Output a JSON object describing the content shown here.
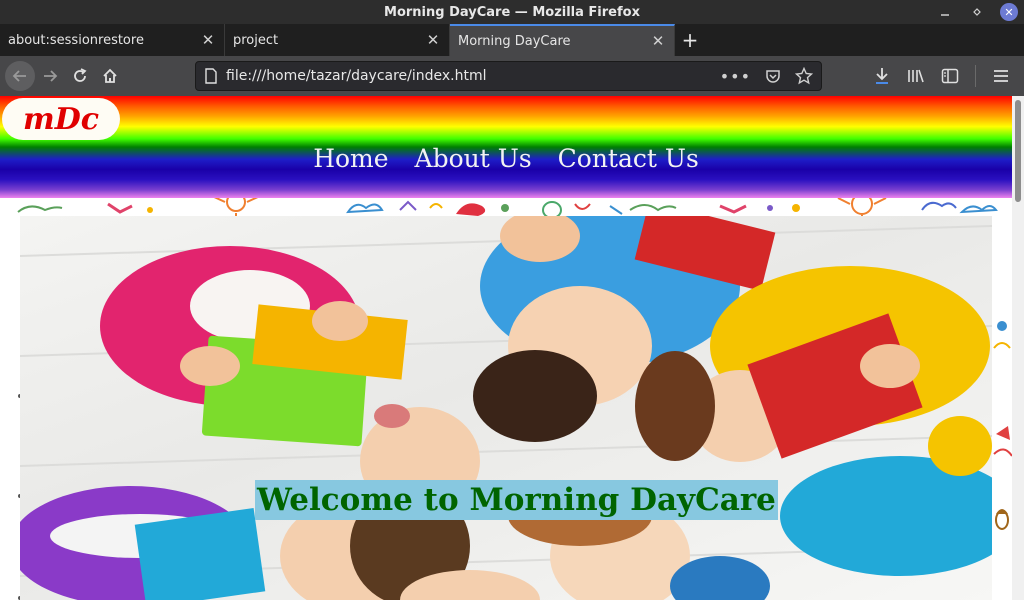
{
  "window": {
    "title": "Morning DayCare — Mozilla Firefox"
  },
  "tabs": [
    {
      "label": "about:sessionrestore",
      "active": false
    },
    {
      "label": "project",
      "active": false
    },
    {
      "label": "Morning DayCare",
      "active": true
    }
  ],
  "urlbar": {
    "url": "file:///home/tazar/daycare/index.html"
  },
  "site": {
    "logo": "mDc",
    "nav": [
      "Home",
      "About Us",
      "Contact Us"
    ],
    "welcome": "Welcome to Morning DayCare"
  },
  "colors": {
    "logo_text": "#e00000",
    "welcome_text": "#006400",
    "welcome_bg": "#87c8e0",
    "accent": "#4a8ae8"
  }
}
